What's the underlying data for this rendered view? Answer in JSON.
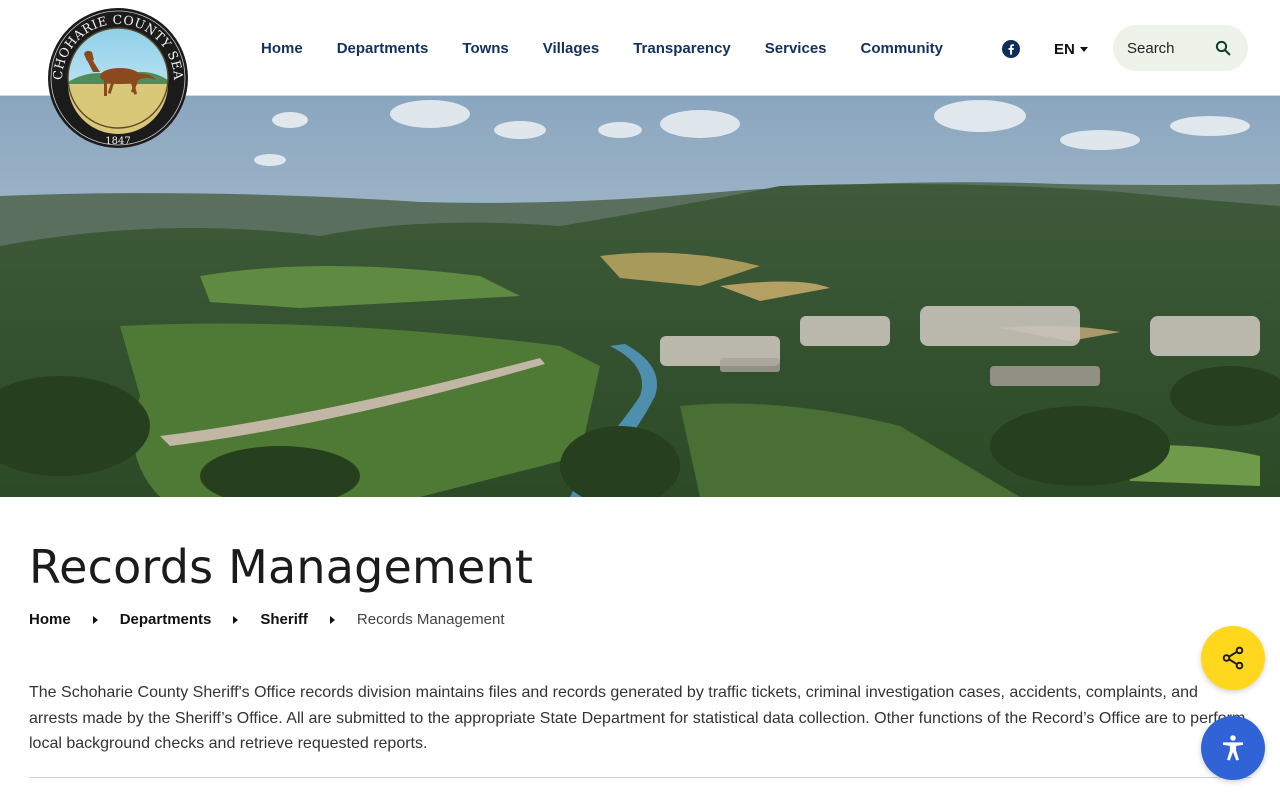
{
  "header": {
    "logo": {
      "seal_text": "SCHOHARIE COUNTY SEAL",
      "year": "1847"
    },
    "nav": [
      {
        "label": "Home"
      },
      {
        "label": "Departments"
      },
      {
        "label": "Towns"
      },
      {
        "label": "Villages"
      },
      {
        "label": "Transparency"
      },
      {
        "label": "Services"
      },
      {
        "label": "Community"
      }
    ],
    "social_icon": "facebook-icon",
    "language": "EN",
    "search": {
      "label": "Search"
    }
  },
  "page": {
    "title": "Records Management",
    "breadcrumb": [
      {
        "label": "Home"
      },
      {
        "label": "Departments"
      },
      {
        "label": "Sheriff"
      },
      {
        "label": "Records Management"
      }
    ],
    "body": "The Schoharie County Sheriff's Office records division maintains files and records generated by traffic tickets, criminal investigation cases, accidents, complaints, and arrests made by the Sheriff’s Office. All are submitted to the appropriate State Department for statistical data collection. Other functions of the Record’s Office are to perform local background checks and retrieve requested reports."
  },
  "floating": {
    "share_icon": "share-icon",
    "accessibility_icon": "accessibility-icon"
  },
  "colors": {
    "nav_text": "#12315f",
    "search_bg": "#eef3ea",
    "share_button": "#ffd71c",
    "accessibility_button": "#2f63d6"
  }
}
